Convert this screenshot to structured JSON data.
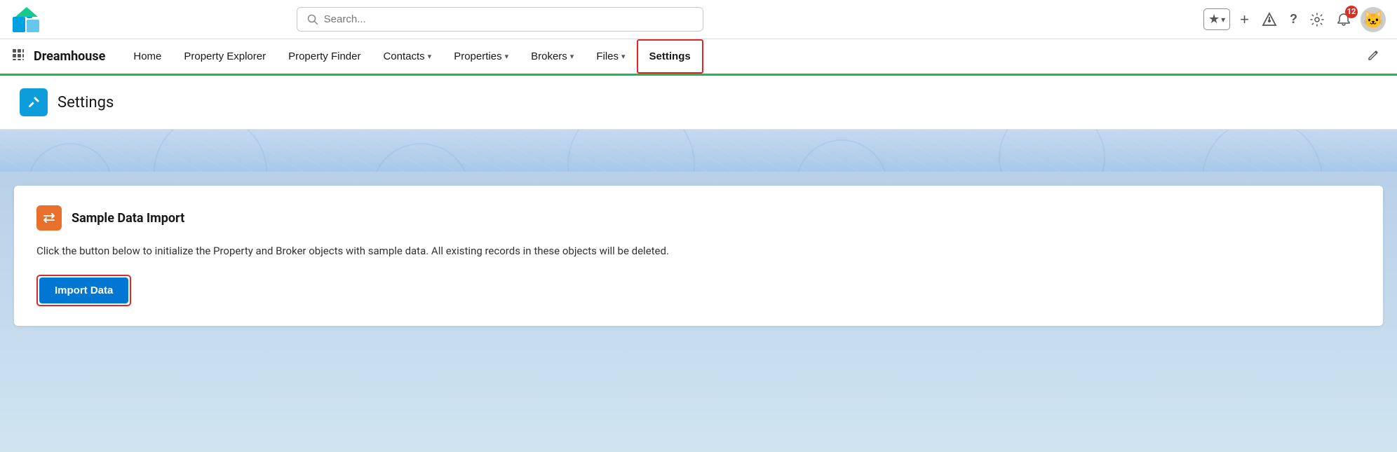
{
  "topBar": {
    "search": {
      "placeholder": "Search...",
      "value": ""
    },
    "actions": {
      "favorites_label": "★",
      "chevron_label": "▾",
      "add_label": "+",
      "trailhead_label": "⬡",
      "help_label": "?",
      "setup_label": "⚙",
      "notifications_label": "🔔",
      "notifications_count": "12",
      "avatar_label": "🐱"
    }
  },
  "nav": {
    "app_name": "Dreamhouse",
    "items": [
      {
        "label": "Home",
        "has_chevron": false,
        "active": false
      },
      {
        "label": "Property Explorer",
        "has_chevron": false,
        "active": false
      },
      {
        "label": "Property Finder",
        "has_chevron": false,
        "active": false
      },
      {
        "label": "Contacts",
        "has_chevron": true,
        "active": false
      },
      {
        "label": "Properties",
        "has_chevron": true,
        "active": false
      },
      {
        "label": "Brokers",
        "has_chevron": true,
        "active": false
      },
      {
        "label": "Files",
        "has_chevron": true,
        "active": false
      },
      {
        "label": "Settings",
        "has_chevron": false,
        "active": true
      }
    ]
  },
  "pageHeader": {
    "title": "Settings",
    "icon": "🔧"
  },
  "card": {
    "title": "Sample Data Import",
    "icon": "⇄",
    "description": "Click the button below to initialize the Property and Broker objects with sample data. All existing records in these objects will be deleted.",
    "import_button_label": "Import Data"
  }
}
